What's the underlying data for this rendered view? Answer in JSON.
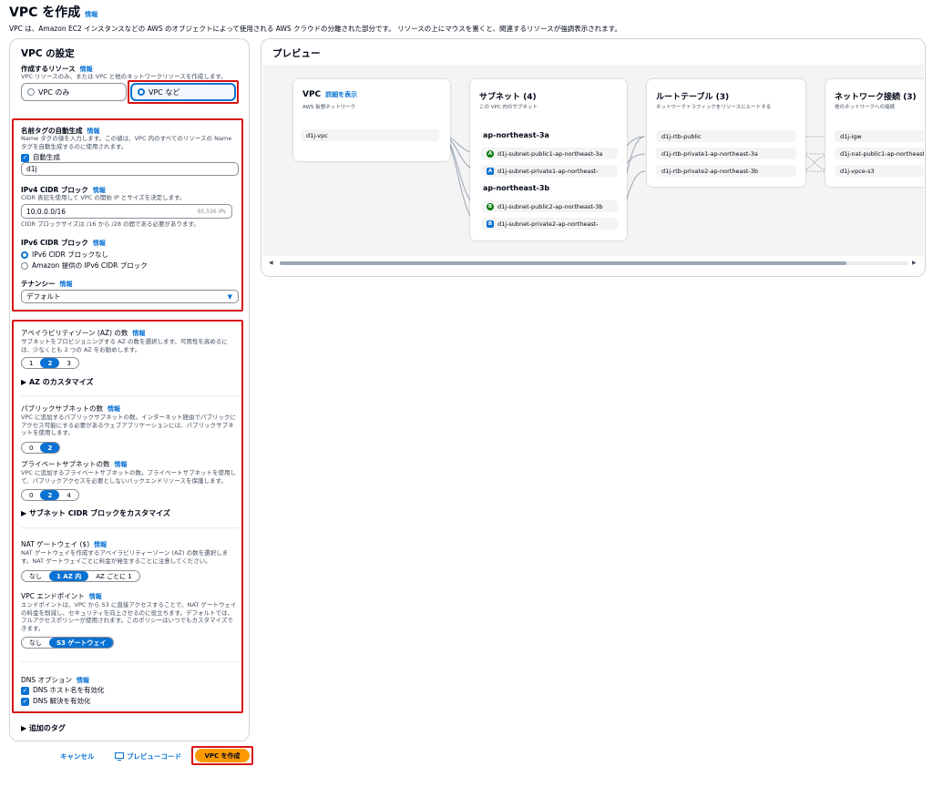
{
  "header": {
    "title": "VPC を作成",
    "info": "情報",
    "description": "VPC は、Amazon EC2 インスタンスなどの AWS のオブジェクトによって使用される AWS クラウドの分離された部分です。 リソースの上にマウスを置くと、関連するリソースが強調表示されます。"
  },
  "settings": {
    "title": "VPC の設定",
    "resources": {
      "label": "作成するリソース",
      "info": "情報",
      "desc": "VPC リソースのみ、または VPC と他のネットワークリソースを作成します。",
      "options": [
        "VPC のみ",
        "VPC など"
      ],
      "selected": "VPC など"
    },
    "name_tag": {
      "label": "名前タグの自動生成",
      "info": "情報",
      "desc": "Name タグの値を入力します。この値は、VPC 内のすべてのリソースの Name タグを自動生成するのに使用されます。",
      "checkbox": "自動生成",
      "value": "d1j"
    },
    "ipv4": {
      "label": "IPv4 CIDR ブロック",
      "info": "情報",
      "desc": "CIDR 表記を使用して VPC の開始 IP とサイズを決定します。",
      "value": "10.0.0.0/16",
      "suffix": "65,536 IPs",
      "hint": "CIDR ブロックサイズは /16 から /28 の間である必要があります。"
    },
    "ipv6": {
      "label": "IPv6 CIDR ブロック",
      "info": "情報",
      "options": [
        "IPv6 CIDR ブロックなし",
        "Amazon 提供の IPv6 CIDR ブロック"
      ]
    },
    "tenancy": {
      "label": "テナンシー",
      "info": "情報",
      "value": "デフォルト"
    },
    "az": {
      "label": "アベイラビリティゾーン (AZ) の数",
      "info": "情報",
      "desc": "サブネットをプロビジョニングする AZ の数を選択します。可用性を高めるには、少なくとも 2 つの AZ をお勧めします。",
      "options": [
        "1",
        "2",
        "3"
      ],
      "selected": "2",
      "customize": "AZ のカスタマイズ"
    },
    "public_subnets": {
      "label": "パブリックサブネットの数",
      "info": "情報",
      "desc": "VPC に追加するパブリックサブネットの数。インターネット経由でパブリックにアクセス可能にする必要があるウェブアプリケーションには、パブリックサブネットを使用します。",
      "options": [
        "0",
        "2"
      ],
      "selected": "2"
    },
    "private_subnets": {
      "label": "プライベートサブネットの数",
      "info": "情報",
      "desc": "VPC に追加するプライベートサブネットの数。プライベートサブネットを使用して、パブリックアクセスを必要としないバックエンドリソースを保護します。",
      "options": [
        "0",
        "2",
        "4"
      ],
      "selected": "2",
      "customize": "サブネット CIDR ブロックをカスタマイズ"
    },
    "nat": {
      "label": "NAT ゲートウェイ ($)",
      "info": "情報",
      "desc": "NAT ゲートウェイを作成するアベイラビリティーゾーン (AZ) の数を選択します。NAT ゲートウェイごとに料金が発生することに注意してください。",
      "options": [
        "なし",
        "1 AZ 内",
        "AZ ごとに 1"
      ],
      "selected": "1 AZ 内"
    },
    "endpoint": {
      "label": "VPC エンドポイント",
      "info": "情報",
      "desc": "エンドポイントは、VPC から S3 に直接アクセスすることで、NAT ゲートウェイの料金を削減し、セキュリティを向上させるのに役立ちます。デフォルトでは、フルアクセスポリシーが使用されます。このポリシーはいつでもカスタマイズできます。",
      "options": [
        "なし",
        "S3 ゲートウェイ"
      ],
      "selected": "S3 ゲートウェイ"
    },
    "dns": {
      "label": "DNS オプション",
      "info": "情報",
      "options": [
        "DNS ホスト名を有効化",
        "DNS 解決を有効化"
      ]
    },
    "tags": "追加のタグ"
  },
  "preview": {
    "title": "プレビュー",
    "vpc": {
      "title": "VPC",
      "link": "詳細を表示",
      "sub": "AWS 仮想ネットワーク",
      "node": "d1j-vpc"
    },
    "subnets": {
      "title": "サブネット (4)",
      "sub": "この VPC 内のサブネット",
      "zones": [
        {
          "name": "ap-northeast-3a",
          "items": [
            {
              "badge": "A",
              "type": "pub",
              "label": "d1j-subnet-public1-ap-northeast-3a"
            },
            {
              "badge": "A",
              "type": "pri",
              "label": "d1j-subnet-private1-ap-northeast-"
            }
          ]
        },
        {
          "name": "ap-northeast-3b",
          "items": [
            {
              "badge": "B",
              "type": "pub",
              "label": "d1j-subnet-public2-ap-northeast-3b"
            },
            {
              "badge": "B",
              "type": "pri",
              "label": "d1j-subnet-private2-ap-northeast-"
            }
          ]
        }
      ]
    },
    "routes": {
      "title": "ルートテーブル (3)",
      "sub": "ネットワークトラフィックをリソースにルートする",
      "items": [
        "d1j-rtb-public",
        "d1j-rtb-private1-ap-northeast-3a",
        "d1j-rtb-private2-ap-northeast-3b"
      ]
    },
    "network": {
      "title": "ネットワーク接続 (3)",
      "sub": "他のネットワークへの接続",
      "items": [
        "d1j-igw",
        "d1j-nat-public1-ap-northeast-3a",
        "d1j-vpce-s3"
      ]
    }
  },
  "footer": {
    "cancel": "キャンセル",
    "preview_code": "プレビューコード",
    "create": "VPC を作成"
  },
  "colors": {
    "accent": "#0972d3",
    "highlight": "#d91515",
    "primary_button": "#ff9900"
  }
}
